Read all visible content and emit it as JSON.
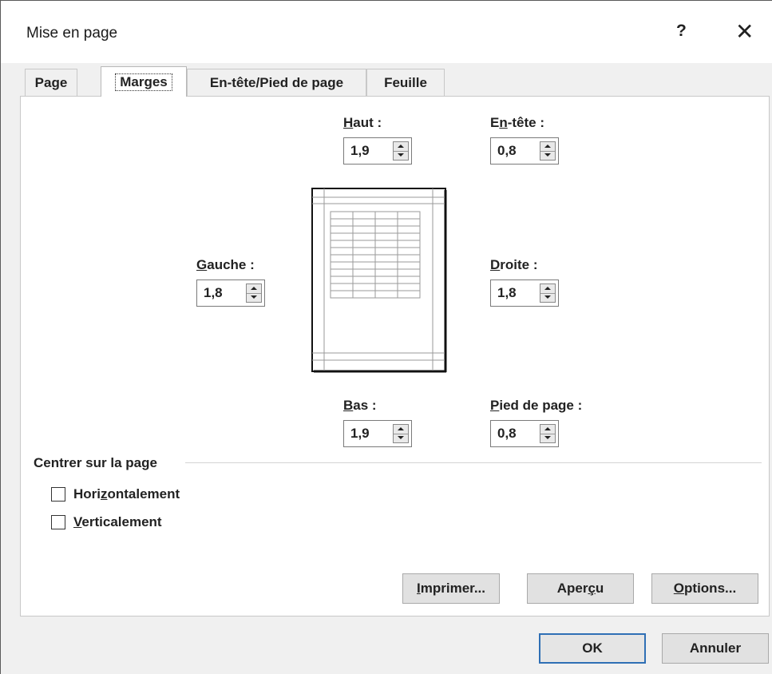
{
  "dialog": {
    "title": "Mise en page",
    "help_glyph": "?",
    "close_glyph": "✕"
  },
  "tabs": [
    {
      "label": "Page"
    },
    {
      "label": "Marges"
    },
    {
      "label": "En-tête/Pied de page"
    },
    {
      "label": "Feuille"
    }
  ],
  "active_tab": "Marges",
  "margins": {
    "haut": {
      "label_u": "H",
      "label_rest": "aut :",
      "value": "1,9"
    },
    "entete": {
      "label_pre": "E",
      "label_u": "n",
      "label_rest": "-tête :",
      "value": "0,8"
    },
    "gauche": {
      "label_u": "G",
      "label_rest": "auche :",
      "value": "1,8"
    },
    "droite": {
      "label_u": "D",
      "label_rest": "roite :",
      "value": "1,8"
    },
    "bas": {
      "label_u": "B",
      "label_rest": "as :",
      "value": "1,9"
    },
    "pied": {
      "label_u": "P",
      "label_rest": "ied de page :",
      "value": "0,8"
    }
  },
  "center": {
    "group_label": "Centrer sur la page",
    "horizontal": {
      "pre": "Hori",
      "u": "z",
      "rest": "ontalement",
      "checked": false
    },
    "vertical": {
      "u": "V",
      "rest": "erticalement",
      "checked": false
    }
  },
  "buttons": {
    "imprimer": {
      "u": "I",
      "rest": "mprimer..."
    },
    "apercu": {
      "pre": "Aper",
      "u": "ç",
      "rest": "u"
    },
    "options": {
      "u": "O",
      "rest": "ptions..."
    },
    "ok": "OK",
    "annuler": "Annuler"
  },
  "icons": {
    "spinner": "spinner-arrows-icon",
    "page_preview": "page-margins-preview-icon",
    "close": "close-icon",
    "help": "help-icon"
  }
}
